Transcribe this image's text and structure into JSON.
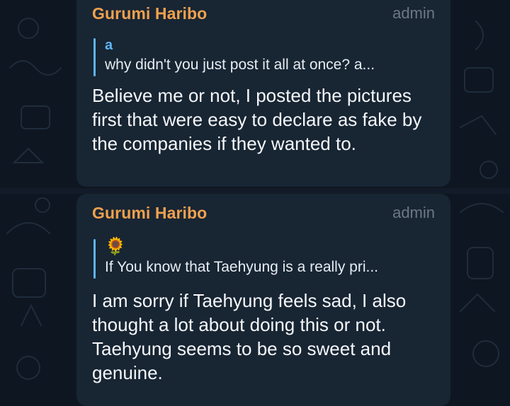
{
  "messages": [
    {
      "sender": "Gurumi Haribo",
      "role": "admin",
      "reply": {
        "author": "a",
        "text": "why didn't you just post it all at once? a..."
      },
      "text": "Believe me or not, I posted the pictures first that were easy to declare as fake by the companies if they wanted to."
    },
    {
      "sender": "Gurumi Haribo",
      "role": "admin",
      "reply": {
        "author_icon": "🌻",
        "text": "If You know that Taehyung is a really pri..."
      },
      "text": "I am sorry if Taehyung feels sad, I also thought a lot about doing this or not. Taehyung seems to be so sweet and genuine."
    }
  ],
  "colors": {
    "background": "#0e1621",
    "bubble": "#182533",
    "sender": "#f0a14e",
    "role": "#6c7883",
    "reply_accent": "#5eb5f7",
    "text": "#f5f7fa"
  }
}
